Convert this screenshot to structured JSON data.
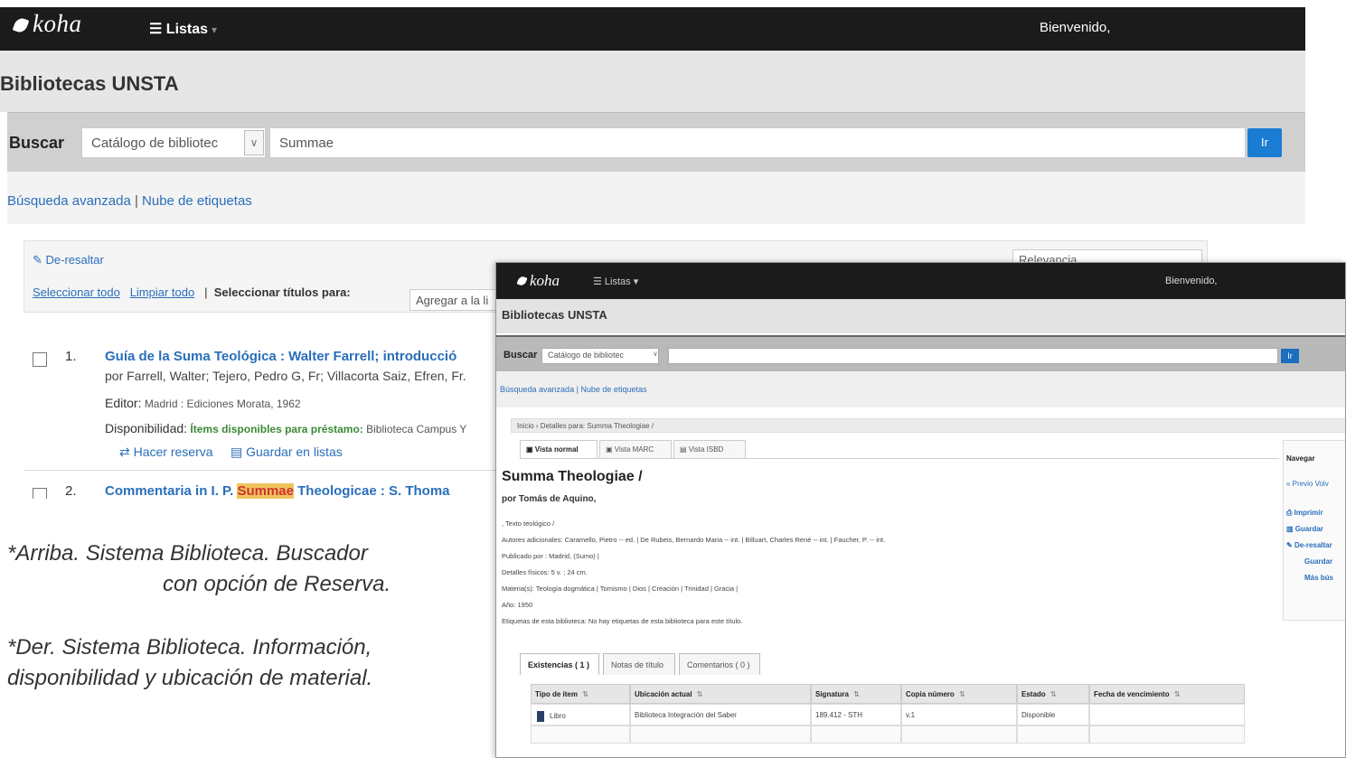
{
  "main": {
    "logo": "koha",
    "lists_menu": "Listas",
    "welcome": "Bienvenido,",
    "library_title": "Bibliotecas UNSTA",
    "search_label": "Buscar",
    "catalog_select": "Catálogo de bibliotec",
    "search_value": "Summae",
    "go_button": "Ir",
    "advanced_search": "Búsqueda avanzada",
    "tag_cloud": "Nube de etiquetas",
    "unhighlight": "De-resaltar",
    "relevance": "Relevancia",
    "select_all": "Seleccionar todo",
    "clear_all": "Limpiar todo",
    "select_titles_for": "Seleccionar títulos para:",
    "add_to": "Agregar a la li"
  },
  "results": [
    {
      "num": "1.",
      "title": "Guía de la Suma Teológica : Walter Farrell; introducció",
      "author": "por Farrell, Walter; Tejero, Pedro G, Fr; Villacorta Saiz, Efren, Fr.",
      "publisher_label": "Editor:",
      "publisher": "Madrid : Ediciones Morata, 1962",
      "availability_label": "Disponibilidad:",
      "availability": "Ítems disponibles para préstamo:",
      "availability_loc": "Biblioteca Campus Y",
      "place_hold": "Hacer reserva",
      "save_to_lists": "Guardar en listas"
    },
    {
      "num": "2.",
      "title_before": "Commentaria in I. P.",
      "title_highlight": "Summae",
      "title_after": "Theologicae : S. Thoma"
    }
  ],
  "captions": {
    "top_line1": "*Arriba. Sistema Biblioteca. Buscador",
    "top_line2": "con opción de Reserva.",
    "right_line1": "*Der. Sistema Biblioteca. Información,",
    "right_line2": "disponibilidad  y ubicación de material."
  },
  "overlay": {
    "logo": "koha",
    "lists": "Listas",
    "welcome": "Bienvenido,",
    "library_title": "Bibliotecas UNSTA",
    "search_label": "Buscar",
    "catalog_select": "Catálogo de bibliotec",
    "go_button": "Ir",
    "adv_links": "Búsqueda avanzada | Nube de etiquetas",
    "breadcrumb": "Inicio › Detalles para: Summa Theologiae /",
    "tabs": [
      "Vista normal",
      "Vista MARC",
      "Vista ISBD"
    ],
    "record_title": "Summa Theologiae /",
    "by_line": "por Tomás de Aquino,",
    "meta_type": ", Texto teológico /",
    "meta_authors": "Autores adicionales: Caramello, Pietro -- ed. | De Rubeis, Bernardo Maria -- int. | Billuart, Charles René -- int. | Faucher, P. -- int.",
    "meta_published": "Publicado por : Madrid, (Sumo) |",
    "meta_physical": "Detalles físicos: 5 v. ; 24 cm.",
    "meta_subjects": "Materia(s): Teología dogmática | Tomismo | Dios | Creación | Trinidad | Gracia |",
    "meta_year": "Año: 1950",
    "meta_tags": "Etiquetas de esta biblioteca: No hay etiquetas de esta biblioteca para este título.",
    "side": [
      "Navegar",
      "« Previo  Volv",
      "Imprimir",
      "Guardar",
      "De-resaltar",
      "Guardar",
      "Más bús"
    ],
    "holdings_tabs": [
      "Existencias ( 1 )",
      "Notas de título",
      "Comentarios ( 0 )"
    ],
    "table_headers": [
      "Tipo de ítem",
      "Ubicación actual",
      "Signatura",
      "Copia número",
      "Estado",
      "Fecha de vencimiento"
    ],
    "table_row": [
      "Libro",
      "Biblioteca Integración del Saber",
      "189.412 - STH",
      "v.1",
      "Disponible",
      ""
    ]
  }
}
